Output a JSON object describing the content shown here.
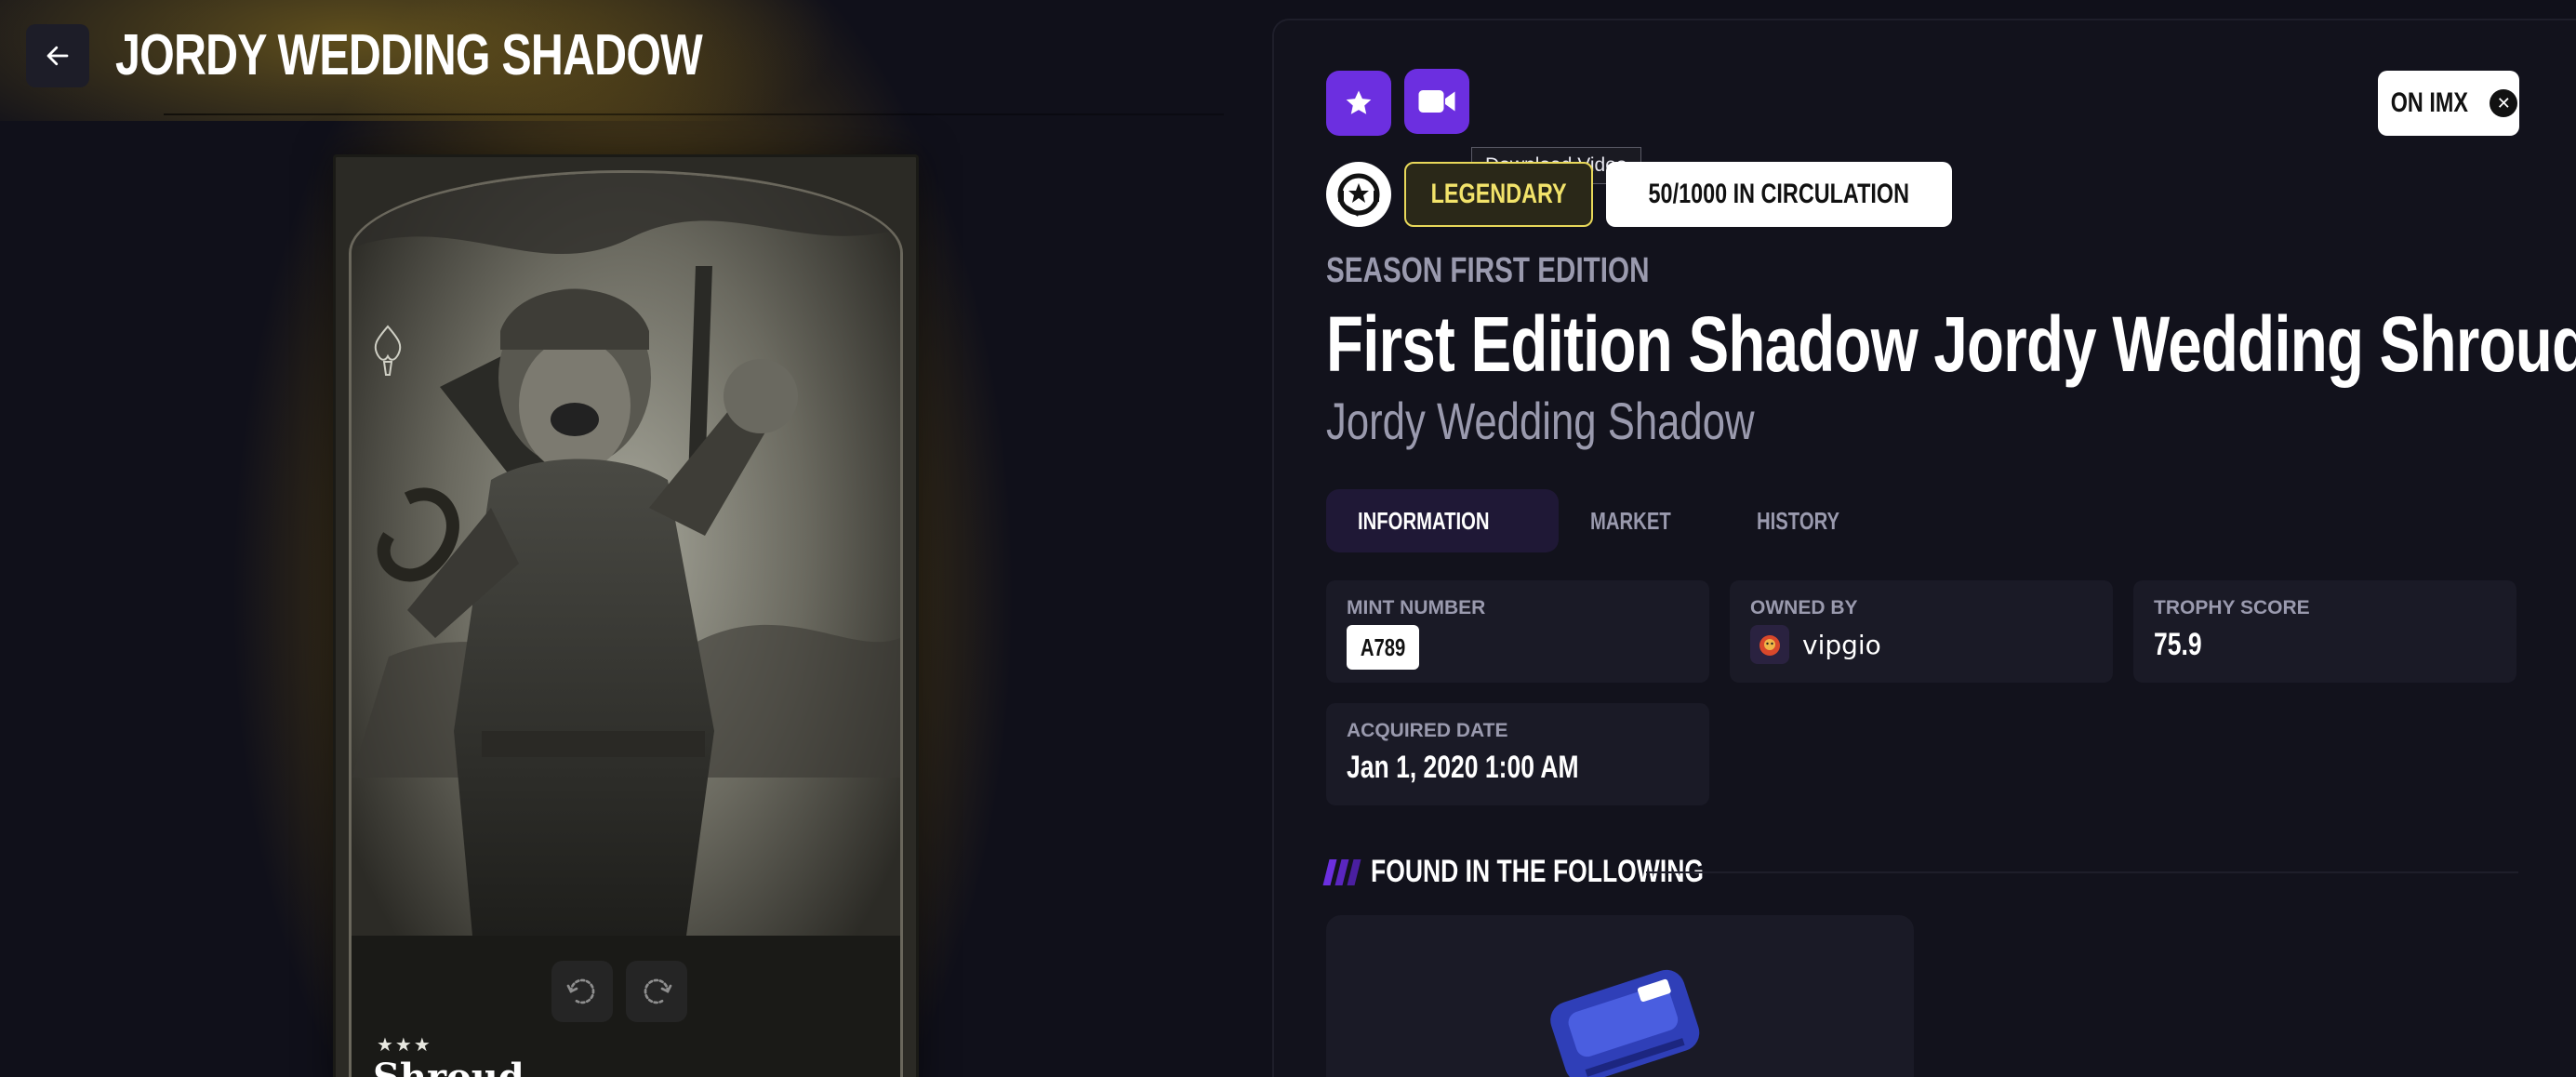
{
  "header": {
    "title": "JORDY WEDDING SHADOW"
  },
  "card": {
    "stars": "★★★",
    "name": "Shroud"
  },
  "actions": {
    "tooltip": "Download Video",
    "imx_label": "ON IMX"
  },
  "badges": {
    "rarity": "LEGENDARY",
    "circulation": "50/1000 IN CIRCULATION"
  },
  "product": {
    "season": "SEASON FIRST EDITION",
    "title": "First Edition Shadow Jordy Wedding Shroud",
    "subtitle": "Jordy Wedding Shadow"
  },
  "tabs": [
    {
      "label": "INFORMATION",
      "active": true
    },
    {
      "label": "MARKET",
      "active": false
    },
    {
      "label": "HISTORY",
      "active": false
    }
  ],
  "info": {
    "mint_number": {
      "label": "MINT NUMBER",
      "value": "A789"
    },
    "owned_by": {
      "label": "OWNED BY",
      "value": "vipgio"
    },
    "trophy_score": {
      "label": "TROPHY SCORE",
      "value": "75.9"
    },
    "acquired_date": {
      "label": "ACQUIRED DATE",
      "value": "Jan 1, 2020 1:00 AM"
    }
  },
  "found_in": {
    "heading": "FOUND IN THE FOLLOWING"
  },
  "colors": {
    "accent": "#6c2fe0",
    "legendary": "#f2e36a",
    "glow": "#dcb428",
    "background": "#10101a",
    "panel": "#12121c"
  },
  "icons": {
    "back": "arrow-left-icon",
    "favorite": "star-icon",
    "video": "video-camera-icon",
    "close": "x-icon",
    "team": "team-logo-icon",
    "rotate_left": "rotate-left-icon",
    "rotate_right": "rotate-right-icon"
  }
}
